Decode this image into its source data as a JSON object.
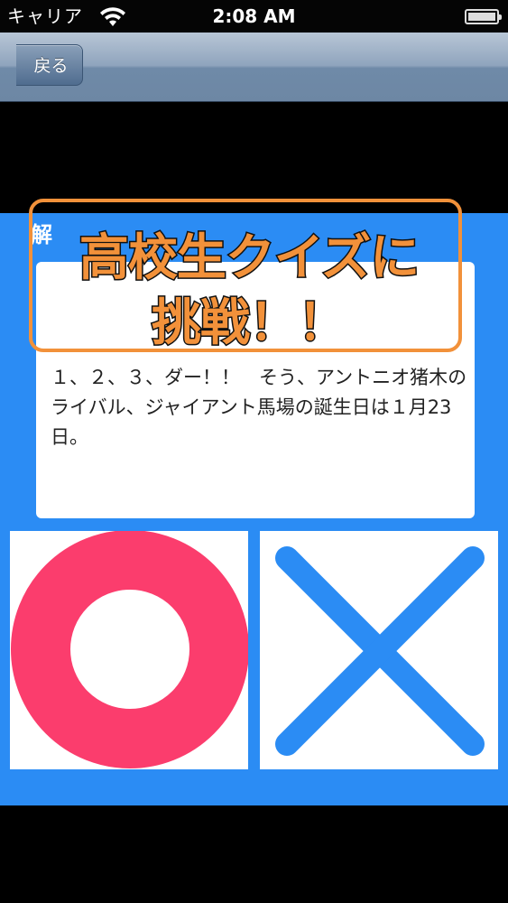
{
  "status_bar": {
    "carrier": "キャリア",
    "time": "2:08 AM"
  },
  "nav": {
    "back_label": "戻る"
  },
  "question": {
    "side_mark": "解",
    "answer_text": "１、２、３、ダー！！　そう、アントニオ猪木のライバル、ジャイアント馬場の誕生日は１月23日。"
  },
  "choices": {
    "correct_icon": "circle-icon",
    "wrong_icon": "cross-icon"
  },
  "banner": {
    "line1": "高校生クイズに",
    "line2": "挑戦！！"
  },
  "colors": {
    "content_bg": "#2b8cf4",
    "circle": "#fb3d6d",
    "cross": "#2b8cf4",
    "banner_text": "#f2913a",
    "banner_border": "#f2913a"
  }
}
